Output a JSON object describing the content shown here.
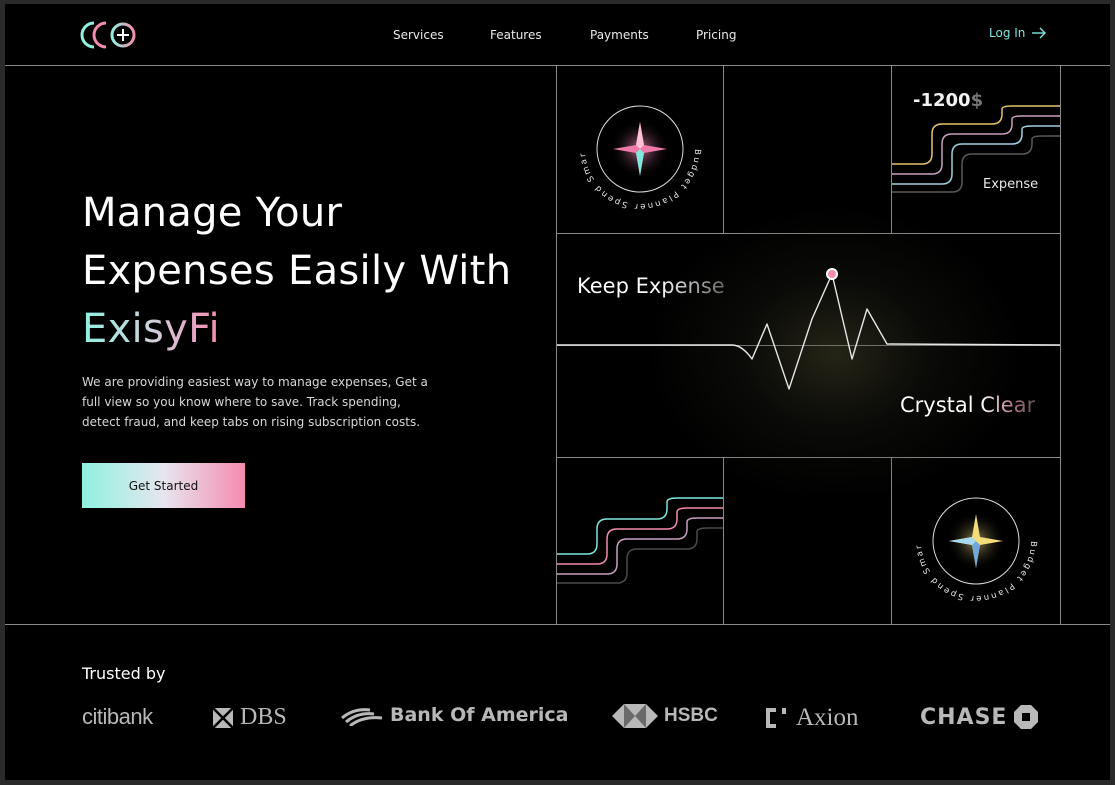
{
  "header": {
    "nav": [
      {
        "label": "Services"
      },
      {
        "label": "Features"
      },
      {
        "label": "Payments"
      },
      {
        "label": "Pricing"
      }
    ],
    "login_label": "Log In"
  },
  "hero": {
    "title_line1": "Manage Your",
    "title_line2": "Expenses Easily With",
    "brand": "ExisyFi",
    "description": "We are providing easiest way to manage expenses, Get a full view so you know where to save. Track spending, detect fraud, and keep tabs on rising subscription costs.",
    "cta_label": "Get Started"
  },
  "grid": {
    "badge_text": "Budget Planner   Spend Smart Save Mor",
    "amount": "-1200",
    "amount_currency": "$",
    "expense_label": "Expense",
    "keep_label": "Keep Expense",
    "crystal_label": "Crystal Clear"
  },
  "trusted": {
    "title": "Trusted by",
    "logos": [
      {
        "name": "citibank"
      },
      {
        "name": "DBS"
      },
      {
        "name": "Bank Of America"
      },
      {
        "name": "HSBC"
      },
      {
        "name": "Axion"
      },
      {
        "name": "CHASE"
      }
    ]
  },
  "colors": {
    "accent_teal": "#8ff1e0",
    "accent_pink": "#f58bb1",
    "background": "#000000",
    "grid_lines": "#8a8a8a"
  }
}
